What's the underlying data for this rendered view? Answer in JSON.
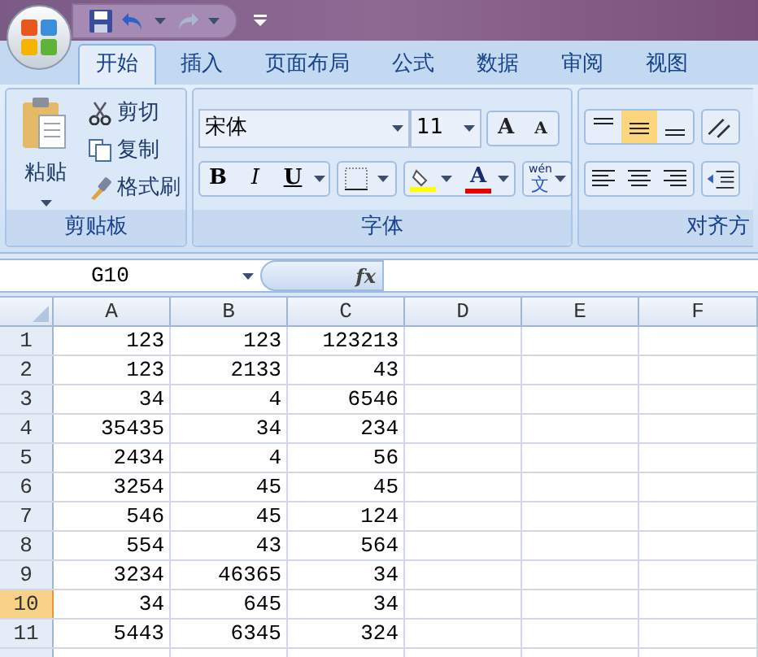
{
  "tabs": [
    {
      "label": "开始",
      "selected": true
    },
    {
      "label": "插入",
      "selected": false
    },
    {
      "label": "页面布局",
      "selected": false
    },
    {
      "label": "公式",
      "selected": false
    },
    {
      "label": "数据",
      "selected": false
    },
    {
      "label": "审阅",
      "selected": false
    },
    {
      "label": "视图",
      "selected": false
    }
  ],
  "clipboard_group": {
    "paste": "粘贴",
    "cut": "剪切",
    "copy": "复制",
    "format_painter": "格式刷",
    "label": "剪贴板"
  },
  "font_group": {
    "font_name": "宋体",
    "font_size": "11",
    "grow": "A",
    "shrink": "A",
    "bold": "B",
    "italic": "I",
    "underline": "U",
    "font_color": "A",
    "phonetic_reading": "wén",
    "phonetic_char": "文",
    "label": "字体"
  },
  "alignment_group": {
    "label": "对齐方"
  },
  "formula_bar": {
    "name_box": "G10",
    "fx": "fx"
  },
  "columns": [
    "A",
    "B",
    "C",
    "D",
    "E",
    "F"
  ],
  "rows": [
    {
      "header": "1",
      "selected": false,
      "cells": [
        "123",
        "123",
        "123213"
      ]
    },
    {
      "header": "2",
      "selected": false,
      "cells": [
        "123",
        "2133",
        "43"
      ]
    },
    {
      "header": "3",
      "selected": false,
      "cells": [
        "34",
        "4",
        "6546"
      ]
    },
    {
      "header": "4",
      "selected": false,
      "cells": [
        "35435",
        "34",
        "234"
      ]
    },
    {
      "header": "5",
      "selected": false,
      "cells": [
        "2434",
        "4",
        "56"
      ]
    },
    {
      "header": "6",
      "selected": false,
      "cells": [
        "3254",
        "45",
        "45"
      ]
    },
    {
      "header": "7",
      "selected": false,
      "cells": [
        "546",
        "45",
        "124"
      ]
    },
    {
      "header": "8",
      "selected": false,
      "cells": [
        "554",
        "43",
        "564"
      ]
    },
    {
      "header": "9",
      "selected": false,
      "cells": [
        "3234",
        "46365",
        "34"
      ]
    },
    {
      "header": "10",
      "selected": true,
      "cells": [
        "34",
        "645",
        "34"
      ]
    },
    {
      "header": "11",
      "selected": false,
      "cells": [
        "5443",
        "6345",
        "324"
      ]
    }
  ]
}
